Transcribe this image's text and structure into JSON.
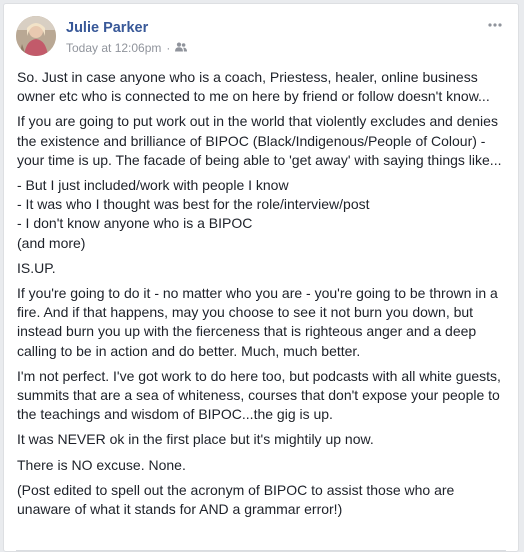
{
  "post": {
    "author": "Julie Parker",
    "timestamp": "Today at 12:06pm",
    "separator": "·",
    "audience_icon": "friends-icon",
    "more_icon": "more-options-icon",
    "paragraphs": [
      "So. Just in case anyone who is a coach, Priestess, healer, online business owner etc who is connected to me on here by friend or follow doesn't know...",
      "If you are going to put work out in the world that violently excludes and denies the existence and brilliance of BIPOC (Black/Indigenous/People of Colour) - your time is up. The facade of being able to 'get away' with saying things like...",
      "- But I just included/work with people I know",
      "- It was who I thought was best for the role/interview/post",
      "- I don't know anyone who is a BIPOC",
      "(and more)",
      "IS.UP.",
      "If you're going to do it - no matter who you are - you're going to be thrown in a fire. And if that happens, may you choose to see it not burn you down, but instead burn you up with the fierceness that is righteous anger and a deep calling to be in action and do better. Much, much better.",
      "I'm not perfect. I've got work to do here too, but podcasts with all white guests, summits that are a sea of whiteness, courses that don't expose your people to the teachings and wisdom of BIPOC...the gig is up.",
      "It was NEVER ok in the first place but it's mightily up now.",
      "There is NO excuse. None.",
      "(Post edited to spell out the acronym of BIPOC to assist those who are unaware of what it stands for AND a grammar error!)"
    ]
  },
  "colors": {
    "author_link": "#385898",
    "meta_text": "#90949c",
    "body_text": "#1d2129",
    "card_border": "#dddfe2"
  }
}
